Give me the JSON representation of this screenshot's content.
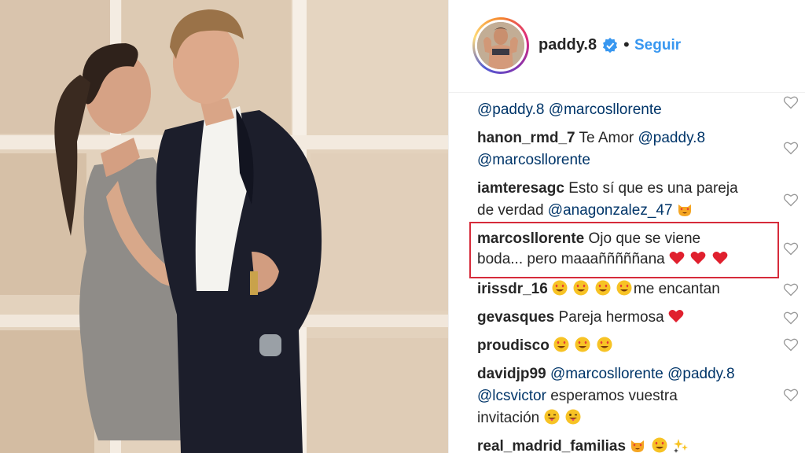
{
  "header": {
    "username": "paddy.8",
    "dot": "•",
    "follow_label": "Seguir"
  },
  "comments": [
    {
      "lines": [
        {
          "mention1": "@paddy.8",
          "mention2": "@marcosllorente"
        }
      ]
    },
    {
      "user": "hanon_rmd_7",
      "text": "Te Amor",
      "mention1": "@paddy.8",
      "mention2": "@marcosllorente"
    },
    {
      "user": "iamteresagc",
      "text1": "Esto sí que es una pareja",
      "text2": "de verdad",
      "mention": "@anagonzalez_47"
    },
    {
      "user": "marcosllorente",
      "text1": "Ojo que se viene",
      "text2": "boda... pero maaañññññana"
    },
    {
      "user": "irissdr_16",
      "text": "me encantan"
    },
    {
      "user": "gevasques",
      "text": "Pareja hermosa"
    },
    {
      "user": "proudisco"
    },
    {
      "user": "davidjp99",
      "mention1": "@marcosllorente",
      "mention2": "@paddy.8",
      "mention3": "@lcsvictor",
      "text1": "esperamos vuestra",
      "text2": "invitación"
    },
    {
      "user": "real_madrid_familias"
    }
  ],
  "icons": {
    "like": "heart-outline-icon",
    "verified": "verified-badge-icon",
    "emoji_heart_eyes": "heart-eyes-emoji",
    "emoji_red_heart": "red-heart-emoji",
    "emoji_cat_heart_eyes": "heart-eyes-cat-emoji",
    "emoji_tongue": "winking-tongue-emoji",
    "emoji_sparkles": "sparkles-emoji"
  },
  "colors": {
    "link": "#3897f0",
    "mention": "#003569",
    "highlight_box": "#d62b3a"
  }
}
